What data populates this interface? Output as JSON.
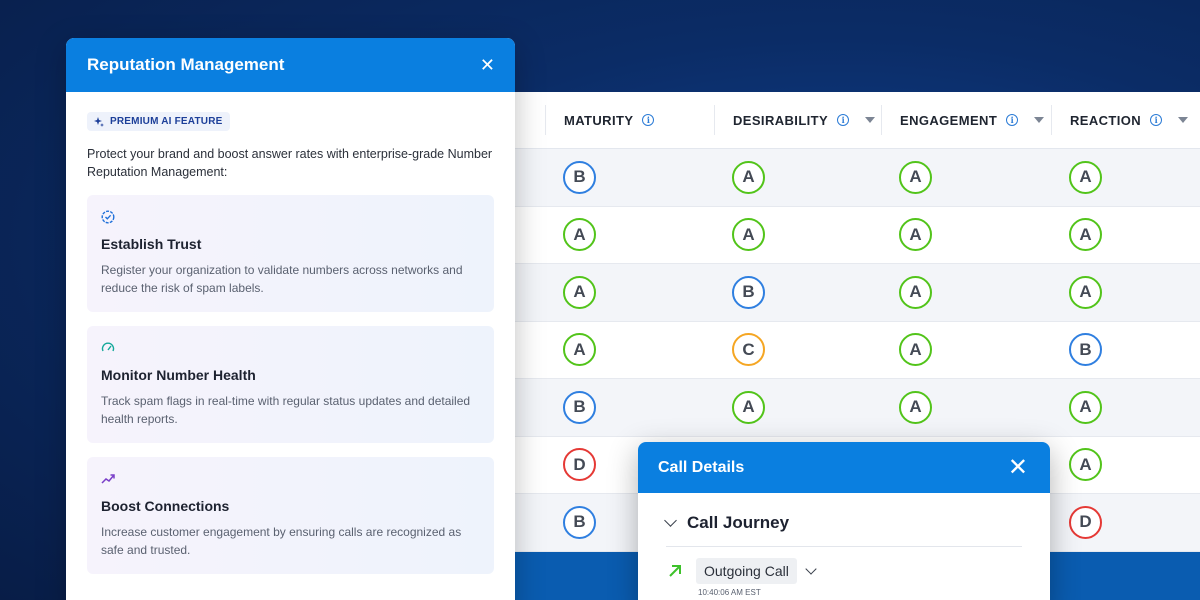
{
  "table": {
    "columns": [
      {
        "label": "MATURITY",
        "has_sort": false
      },
      {
        "label": "DESIRABILITY",
        "has_sort": true
      },
      {
        "label": "ENGAGEMENT",
        "has_sort": true
      },
      {
        "label": "REACTION",
        "has_sort": true
      }
    ],
    "rows": [
      [
        "B",
        "A",
        "A",
        "A"
      ],
      [
        "A",
        "A",
        "A",
        "A"
      ],
      [
        "A",
        "B",
        "A",
        "A"
      ],
      [
        "A",
        "C",
        "A",
        "B"
      ],
      [
        "B",
        "A",
        "A",
        "A"
      ],
      [
        "D",
        "",
        "",
        "A"
      ],
      [
        "B",
        "",
        "",
        "D"
      ]
    ],
    "grade_colors": {
      "A": "#52c41a",
      "B": "#2f7fe0",
      "C": "#f5a623",
      "D": "#e53935"
    }
  },
  "reputation_panel": {
    "title": "Reputation Management",
    "badge": "PREMIUM AI FEATURE",
    "intro": "Protect your brand and boost answer rates with enterprise-grade Number Reputation Management:",
    "features": [
      {
        "icon": "verified-check-icon",
        "title": "Establish Trust",
        "desc": "Register your organization to validate numbers across networks and reduce the risk of spam labels."
      },
      {
        "icon": "gauge-icon",
        "title": "Monitor Number Health",
        "desc": "Track spam flags in real-time with regular status updates and detailed health reports."
      },
      {
        "icon": "trending-up-icon",
        "title": "Boost Connections",
        "desc": "Increase customer engagement by ensuring calls are recognized as safe and trusted."
      }
    ]
  },
  "call_panel": {
    "title": "Call Details",
    "section": "Call Journey",
    "event_label": "Outgoing Call",
    "event_time": "10:40:06 AM EST"
  }
}
